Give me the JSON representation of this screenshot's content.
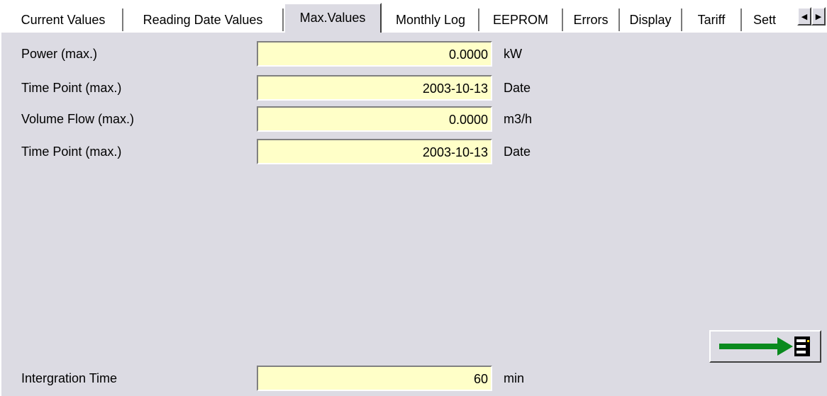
{
  "tabs": [
    {
      "label": "Current Values"
    },
    {
      "label": "Reading Date Values"
    },
    {
      "label": "Max.Values"
    },
    {
      "label": "Monthly Log"
    },
    {
      "label": "EEPROM"
    },
    {
      "label": "Errors"
    },
    {
      "label": "Display"
    },
    {
      "label": "Tariff"
    },
    {
      "label": "Sett"
    }
  ],
  "active_tab": "Max.Values",
  "fields": [
    {
      "label": "Power  (max.)",
      "value": "0.0000",
      "unit": "kW"
    },
    {
      "label": "Time Point  (max.)",
      "value": "2003-10-13",
      "unit": "Date"
    },
    {
      "label": "Volume Flow  (max.)",
      "value": "0.0000",
      "unit": "m3/h"
    },
    {
      "label": "Time Point  (max.)",
      "value": "2003-10-13",
      "unit": "Date"
    }
  ],
  "integration": {
    "label": "Intergration Time",
    "value": "60",
    "unit": "min"
  },
  "icons": {
    "tab_left": "left-arrow-icon",
    "tab_right": "right-arrow-icon",
    "transfer": "arrow-to-device-icon"
  },
  "colors": {
    "panel": "#dcdbe3",
    "field": "#ffffc8",
    "arrow": "#0a8a1e"
  }
}
